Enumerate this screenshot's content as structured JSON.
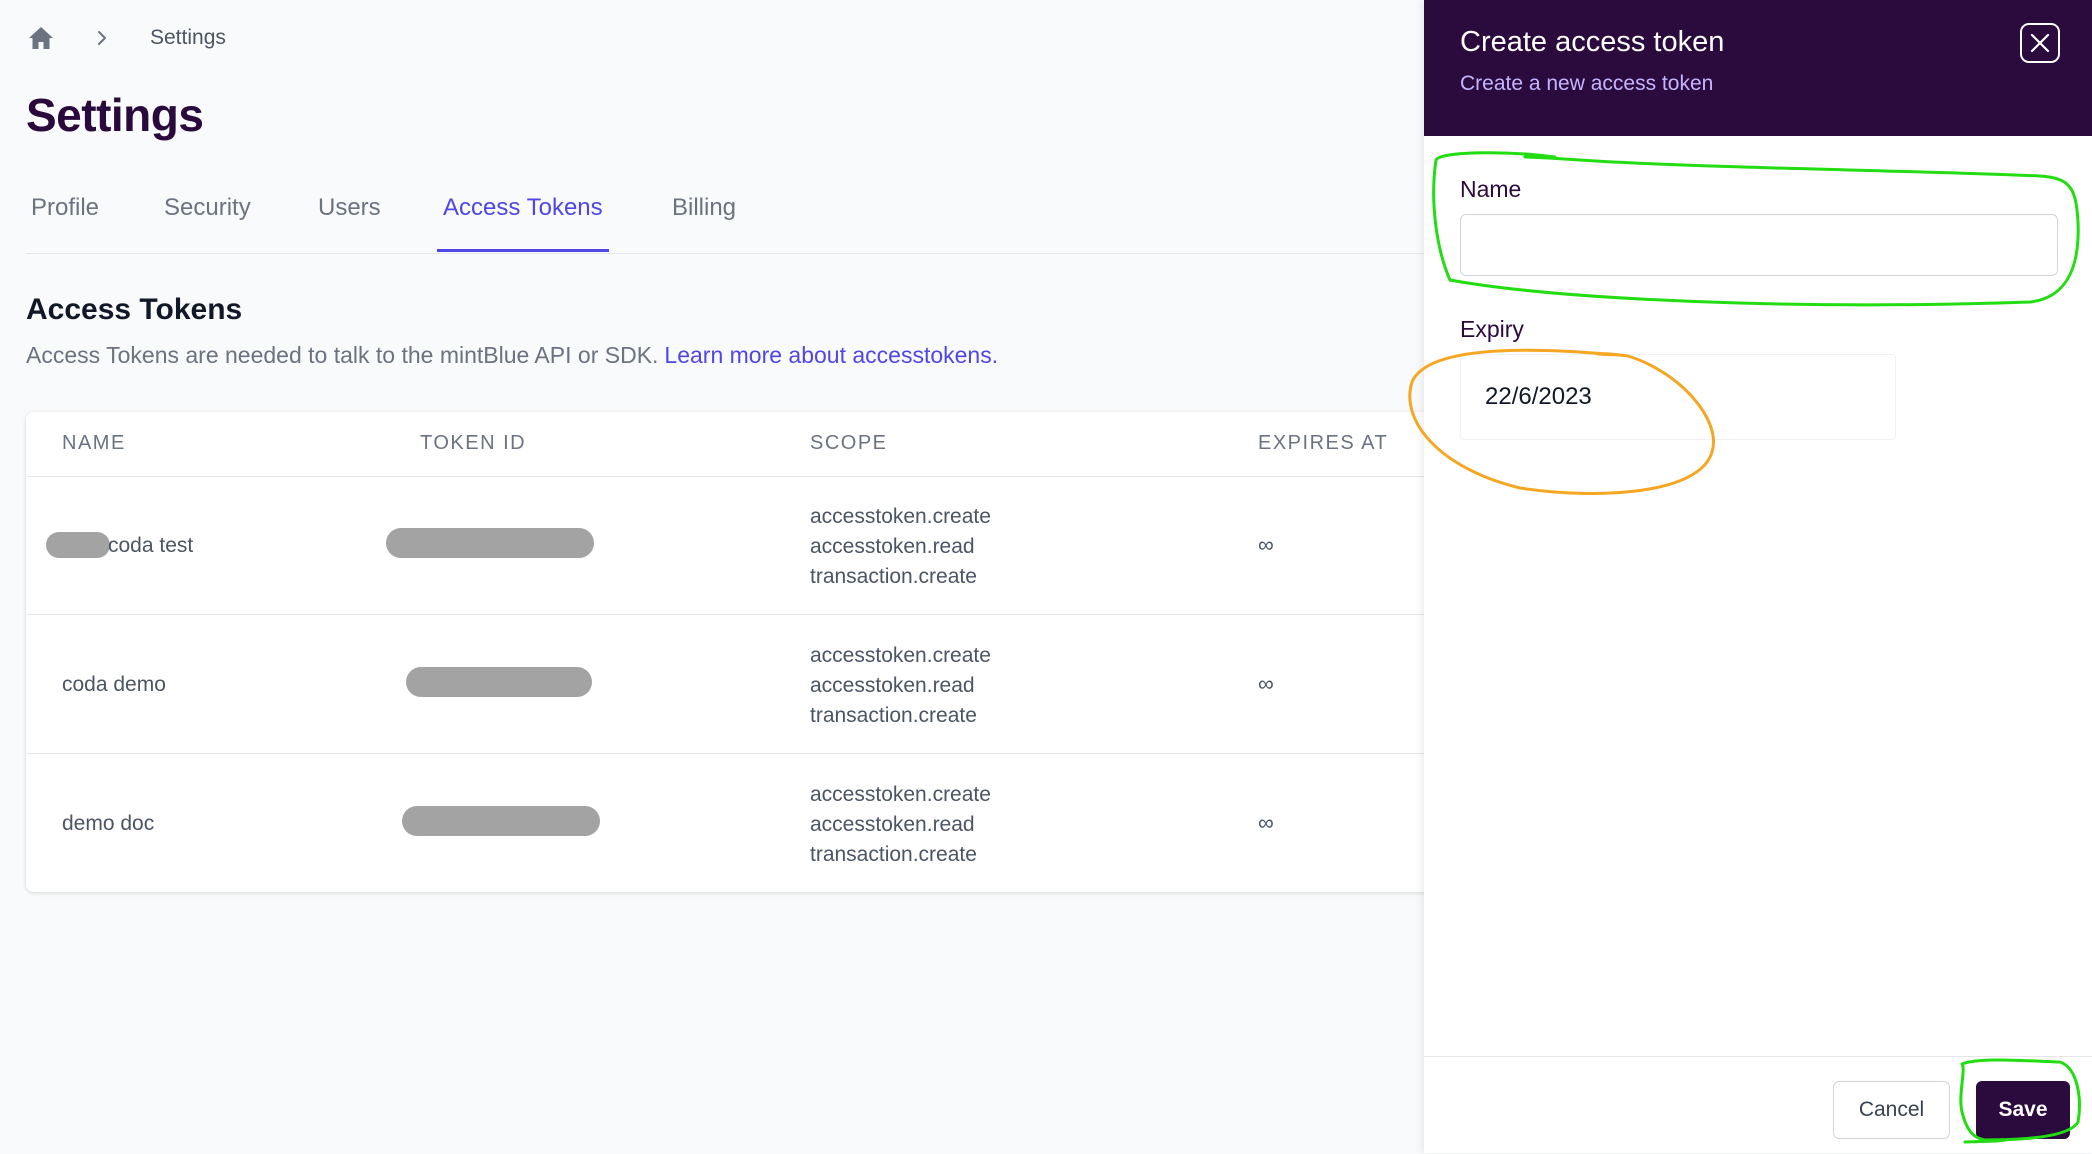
{
  "breadcrumb": {
    "current": "Settings"
  },
  "page": {
    "title": "Settings"
  },
  "tabs": [
    {
      "label": "Profile",
      "active": false
    },
    {
      "label": "Security",
      "active": false
    },
    {
      "label": "Users",
      "active": false
    },
    {
      "label": "Access Tokens",
      "active": true
    },
    {
      "label": "Billing",
      "active": false
    }
  ],
  "section": {
    "title": "Access Tokens",
    "description": "Access Tokens are needed to talk to the mintBlue API or SDK.",
    "link_text": "Learn more about accesstokens."
  },
  "table": {
    "headers": {
      "name": "NAME",
      "token_id": "TOKEN ID",
      "scope": "SCOPE",
      "expires_at": "EXPIRES AT"
    },
    "rows": [
      {
        "name": "coda test",
        "scope": [
          "accesstoken.create",
          "accesstoken.read",
          "transaction.create"
        ],
        "expires": "∞"
      },
      {
        "name": "coda demo",
        "scope": [
          "accesstoken.create",
          "accesstoken.read",
          "transaction.create"
        ],
        "expires": "∞"
      },
      {
        "name": "demo doc",
        "scope": [
          "accesstoken.create",
          "accesstoken.read",
          "transaction.create"
        ],
        "expires": "∞"
      }
    ]
  },
  "panel": {
    "title": "Create access token",
    "subtitle": "Create a new access token",
    "name_label": "Name",
    "name_value": "",
    "expiry_label": "Expiry",
    "expiry_value": "22/6/2023",
    "cancel_label": "Cancel",
    "save_label": "Save"
  },
  "icons": {
    "home": "home-icon",
    "breadcrumb_separator": "chevron-right-icon",
    "close": "close-icon"
  },
  "colors": {
    "brand_dark": "#2b0a3d",
    "accent": "#4f46e5",
    "panel_subtitle": "#c4b5fd",
    "annotation_green": "#22dd11",
    "annotation_orange": "#f5a623"
  }
}
